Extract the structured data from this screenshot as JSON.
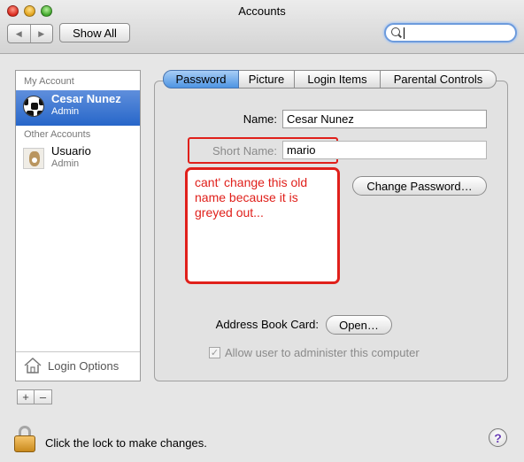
{
  "window": {
    "title": "Accounts"
  },
  "toolbar": {
    "back_glyph": "◀",
    "forward_glyph": "▶",
    "show_all_label": "Show All",
    "search_value": ""
  },
  "sidebar": {
    "my_account_heading": "My Account",
    "my_account": {
      "name": "Cesar Nunez",
      "role": "Admin",
      "icon": "soccer-ball-icon"
    },
    "other_accounts_heading": "Other Accounts",
    "other_accounts": [
      {
        "name": "Usuario",
        "role": "Admin",
        "icon": "dog-photo-icon"
      }
    ],
    "login_options_label": "Login Options",
    "add_glyph": "+",
    "remove_glyph": "–"
  },
  "tabs": [
    {
      "label": "Password",
      "active": true
    },
    {
      "label": "Picture",
      "active": false
    },
    {
      "label": "Login Items",
      "active": false
    },
    {
      "label": "Parental Controls",
      "active": false
    }
  ],
  "form": {
    "name_label": "Name:",
    "name_value": "Cesar Nunez",
    "short_name_label": "Short Name:",
    "short_name_value": "mario",
    "change_password_label": "Change Password…",
    "address_book_label": "Address Book Card:",
    "open_label": "Open…",
    "allow_admin_label": "Allow user to administer this computer",
    "allow_admin_checked": true
  },
  "annotation": {
    "text": "cant' change this old name because it is greyed out...",
    "color": "#e0201b"
  },
  "footer": {
    "lock_text": "Click the lock to make changes.",
    "help_glyph": "?"
  },
  "colors": {
    "selection": "#2766c9",
    "active_tab": "#4e94e3"
  }
}
